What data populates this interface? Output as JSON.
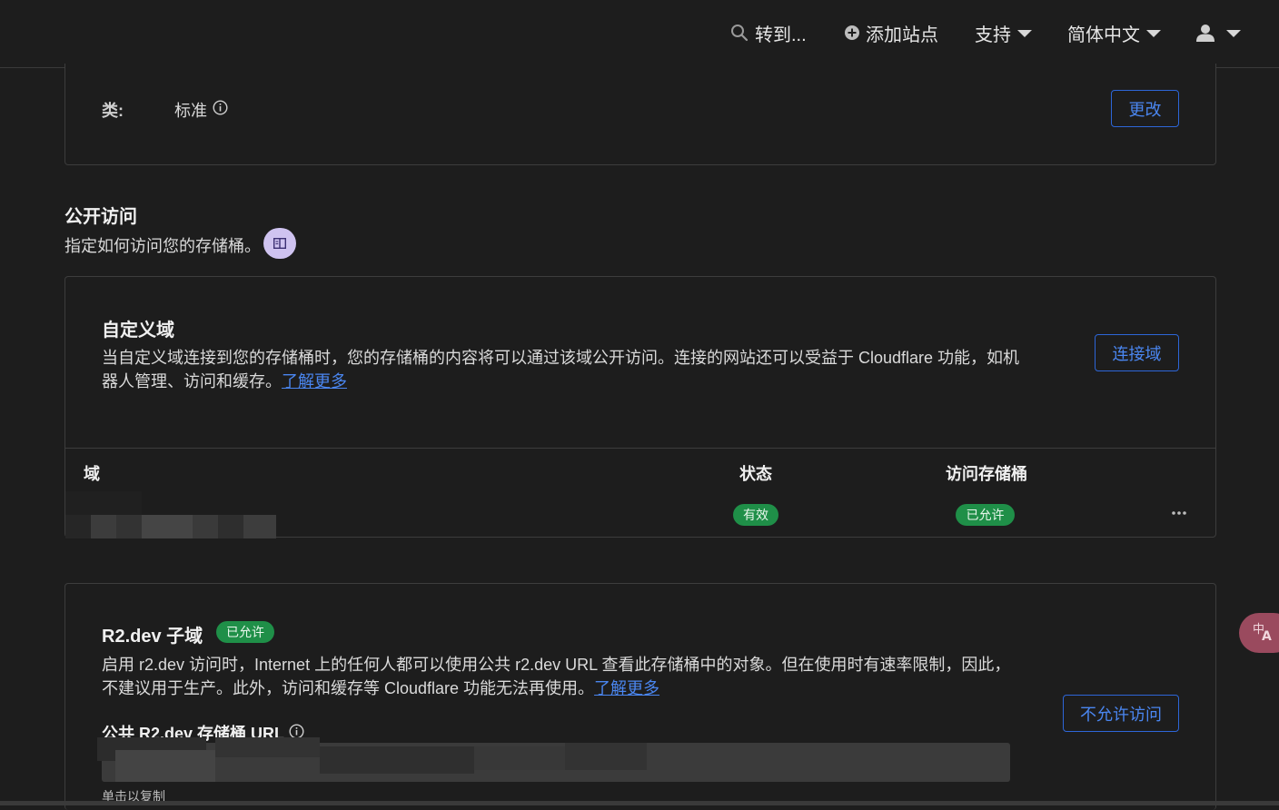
{
  "nav": {
    "goto_label": "转到...",
    "add_site_label": "添加站点",
    "support_label": "支持",
    "language_label": "简体中文"
  },
  "class_card": {
    "label": "类:",
    "value": "标准",
    "change_button": "更改"
  },
  "public_access": {
    "title": "公开访问",
    "description": "指定如何访问您的存储桶。"
  },
  "custom_domain": {
    "title": "自定义域",
    "description_line1": "当自定义域连接到您的存储桶时，您的存储桶的内容将可以通过该域公开访问。连接的网站还可以受益于 Cloudflare 功能，如机",
    "description_line2": "器人管理、访问和缓存。",
    "learn_more": "了解更多",
    "connect_button": "连接域",
    "table": {
      "headers": [
        "域",
        "状态",
        "访问存储桶"
      ],
      "rows": [
        {
          "status": "有效",
          "access": "已允许"
        }
      ]
    }
  },
  "r2dev": {
    "title": "R2.dev 子域",
    "badge": "已允许",
    "description_line1": "启用 r2.dev 访问时，Internet 上的任何人都可以使用公共 r2.dev URL 查看此存储桶中的对象。但在使用时有速率限制，因此，",
    "description_line2": "不建议用于生产。此外，访问和缓存等 Cloudflare 功能无法再使用。",
    "learn_more": "了解更多",
    "disallow_button": "不允许访问",
    "url_label": "公共 R2.dev 存储桶 URL",
    "click_to_copy": "单击以复制"
  },
  "colors": {
    "accent": "#2d66d8",
    "success": "#1f8f48",
    "background": "#1d1d1d"
  }
}
